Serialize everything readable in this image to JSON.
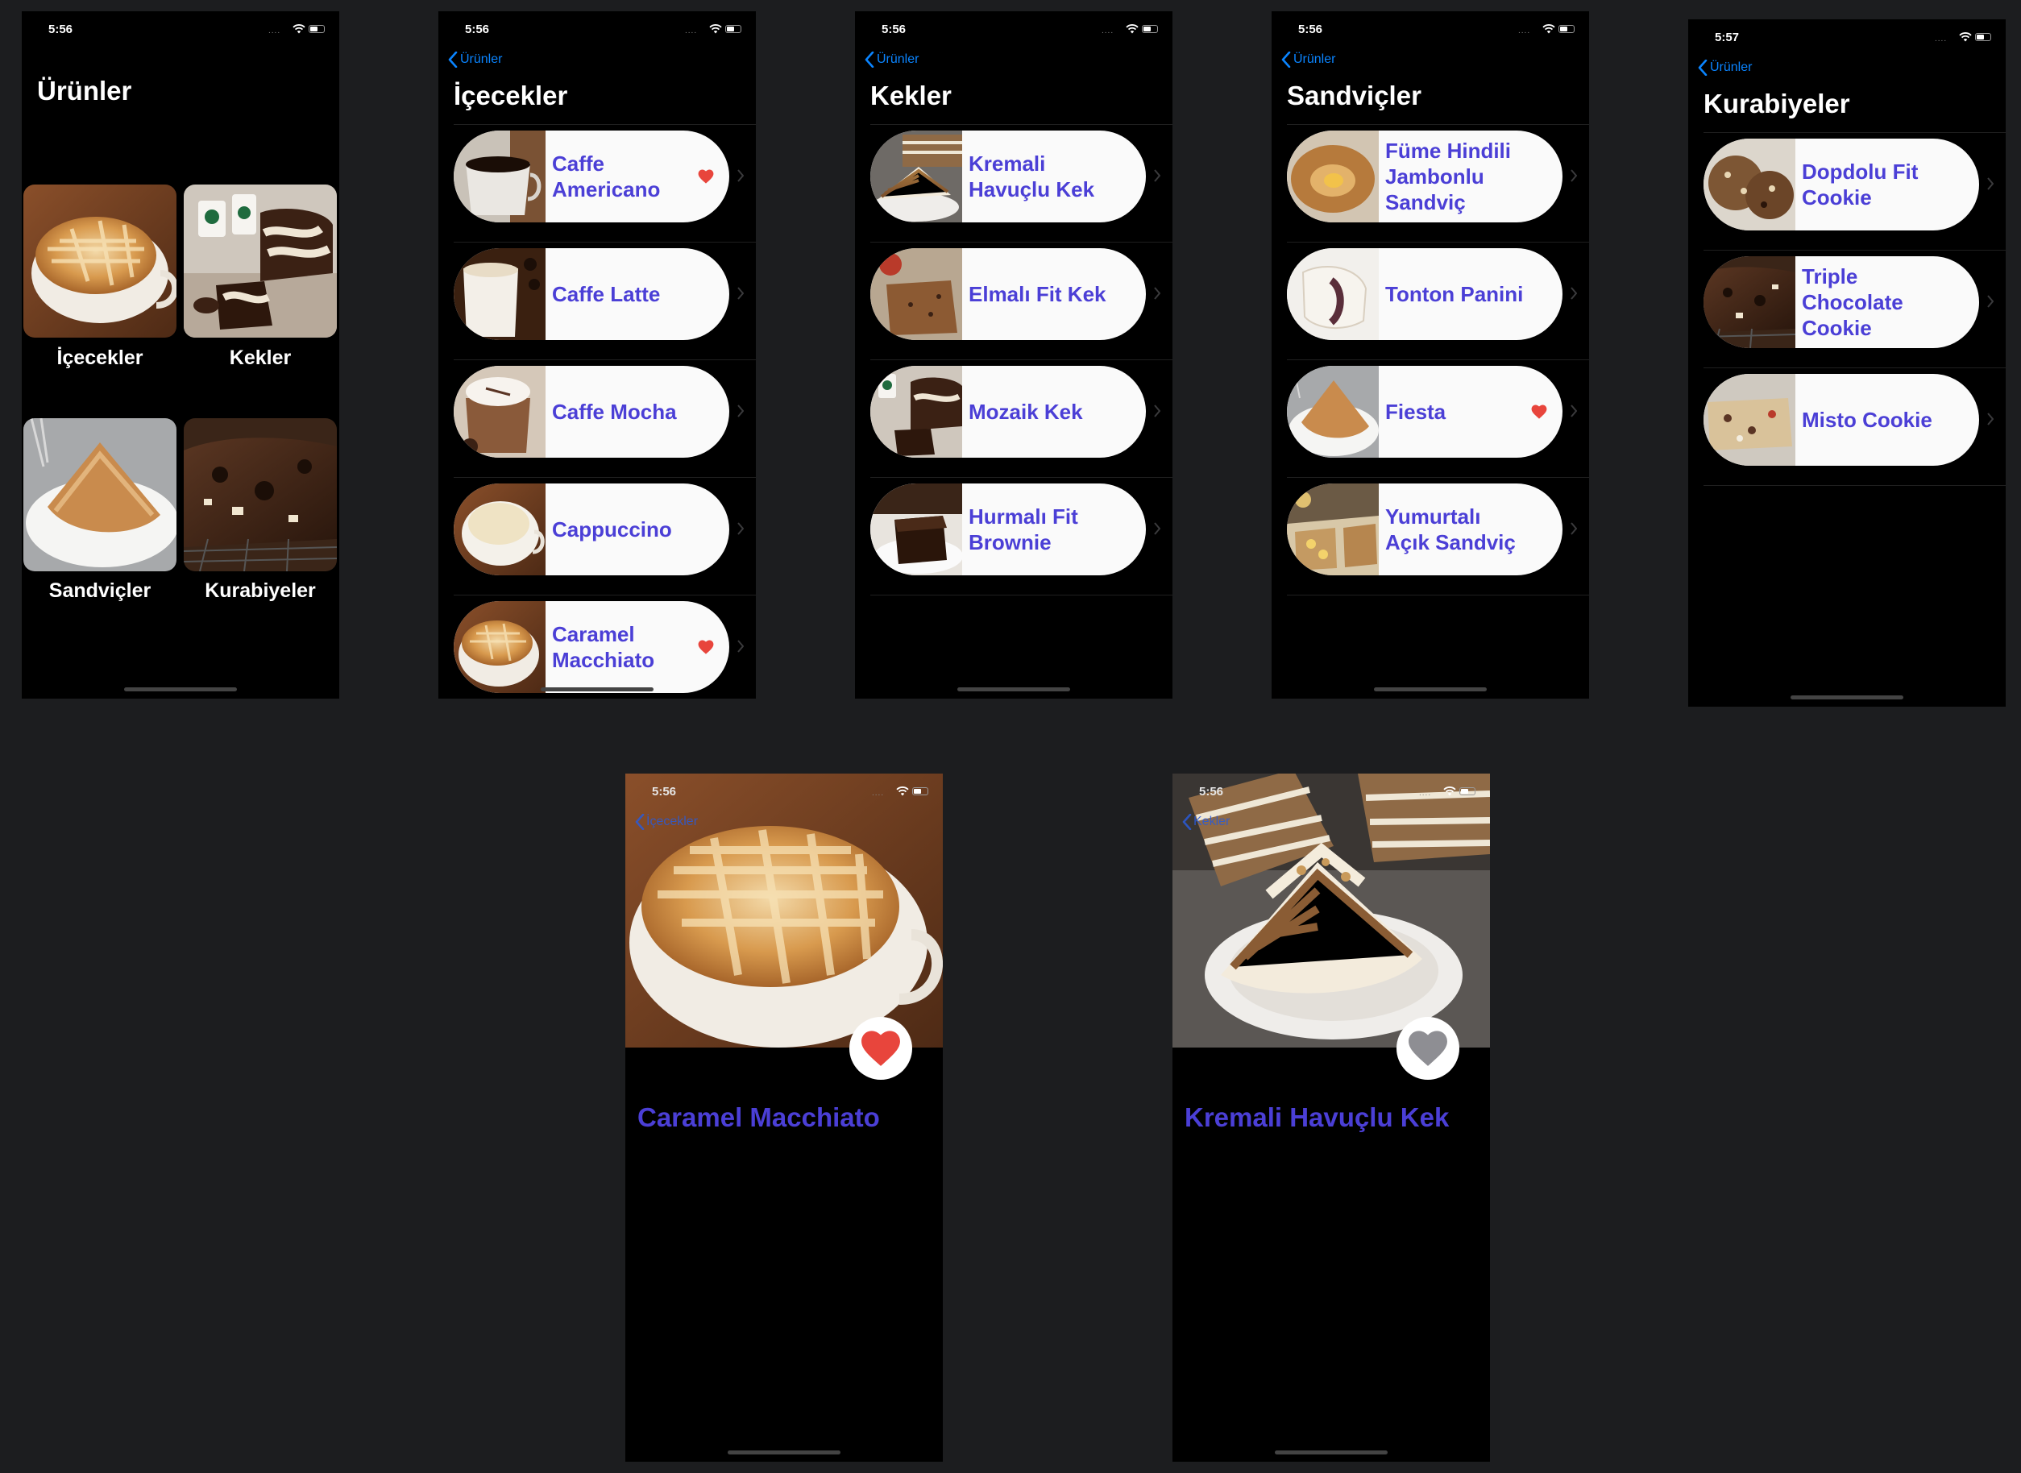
{
  "status": {
    "time_a": "5:56",
    "time_b": "5:57"
  },
  "home": {
    "title": "Ürünler",
    "categories": [
      {
        "label": "İçecekler"
      },
      {
        "label": "Kekler"
      },
      {
        "label": "Sandviçler"
      },
      {
        "label": "Kurabiyeler"
      }
    ]
  },
  "back_label": "Ürünler",
  "icecekler": {
    "title": "İçecekler",
    "items": [
      {
        "name": "Caffe Americano",
        "favorite": true
      },
      {
        "name": "Caffe Latte",
        "favorite": false
      },
      {
        "name": "Caffe Mocha",
        "favorite": false
      },
      {
        "name": "Cappuccino",
        "favorite": false
      },
      {
        "name": "Caramel Macchiato",
        "favorite": true
      }
    ]
  },
  "kekler": {
    "title": "Kekler",
    "items": [
      {
        "name": "Kremali Havuçlu Kek",
        "favorite": false
      },
      {
        "name": "Elmalı Fit Kek",
        "favorite": false
      },
      {
        "name": "Mozaik Kek",
        "favorite": false
      },
      {
        "name": "Hurmalı Fit Brownie",
        "favorite": false
      }
    ]
  },
  "sandvicler": {
    "title": "Sandviçler",
    "items": [
      {
        "name": "Füme Hindili Jambonlu Sandviç",
        "favorite": false
      },
      {
        "name": "Tonton Panini",
        "favorite": false
      },
      {
        "name": "Fiesta",
        "favorite": true
      },
      {
        "name": "Yumurtalı Açık Sandviç",
        "favorite": false
      }
    ]
  },
  "kurabiyeler": {
    "title": "Kurabiyeler",
    "items": [
      {
        "name": "Dopdolu Fit Cookie",
        "favorite": false
      },
      {
        "name": "Triple Chocolate Cookie",
        "favorite": false
      },
      {
        "name": "Misto Cookie",
        "favorite": false
      }
    ]
  },
  "detail_macchiato": {
    "title": "Caramel Macchiato",
    "back": "İçecekler",
    "favorite": true
  },
  "detail_kek": {
    "title": "Kremali Havuçlu Kek",
    "back": "Kekler",
    "favorite": false
  },
  "colors": {
    "accent": "#4b3fd6",
    "heart": "#e8453c",
    "heart_off": "#8e8e93",
    "link": "#0a84ff"
  }
}
